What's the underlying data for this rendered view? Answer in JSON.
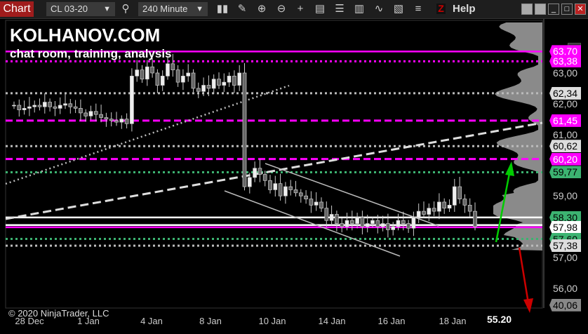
{
  "toolbar": {
    "chart_tab": "Chart",
    "instrument": "CL 03-20",
    "interval": "240 Minute",
    "z_label": "Z",
    "help": "Help"
  },
  "overlay": {
    "brand": "KOLHANOV.COM",
    "subtitle": "chat room, training, analysis",
    "copyright": "© 2020 NinjaTrader, LLC",
    "target": "55.20",
    "f_button": "F"
  },
  "price_axis": {
    "ticks": [
      "63,00",
      "62,00",
      "61,00",
      "59,00",
      "57,00",
      "56,00"
    ]
  },
  "price_labels": [
    {
      "text": "63,70",
      "price": 63.7,
      "bg": "#ff00ff",
      "fg": "#ffffff"
    },
    {
      "text": "63,38",
      "price": 63.38,
      "bg": "#ff00ff",
      "fg": "#ffffff"
    },
    {
      "text": "62,34",
      "price": 62.34,
      "bg": "#dddddd",
      "fg": "#000000"
    },
    {
      "text": "61,45",
      "price": 61.45,
      "bg": "#ff00ff",
      "fg": "#ffffff"
    },
    {
      "text": "60,62",
      "price": 60.62,
      "bg": "#dddddd",
      "fg": "#000000"
    },
    {
      "text": "60,20",
      "price": 60.2,
      "bg": "#ff00ff",
      "fg": "#ffffff"
    },
    {
      "text": "59,77",
      "price": 59.77,
      "bg": "#3cb371",
      "fg": "#000000"
    },
    {
      "text": "58,30",
      "price": 58.3,
      "bg": "#3cb371",
      "fg": "#000000"
    },
    {
      "text": "57,98",
      "price": 57.98,
      "bg": "#ffffff",
      "fg": "#000000"
    },
    {
      "text": "57,60",
      "price": 57.6,
      "bg": "#3cb371",
      "fg": "#000000"
    },
    {
      "text": "57,38",
      "price": 57.38,
      "bg": "#dddddd",
      "fg": "#000000"
    },
    {
      "text": "40,06",
      "price": 55.45,
      "bg": "#888888",
      "fg": "#000000"
    }
  ],
  "date_axis": {
    "ticks": [
      "28 Dec",
      "1 Jan",
      "4 Jan",
      "8 Jan",
      "10 Jan",
      "14 Jan",
      "16 Jan",
      "18 Jan"
    ]
  },
  "chart_data": {
    "type": "candlestick",
    "symbol": "CL 03-20",
    "interval": "240 Minute",
    "closes": [
      61.95,
      61.8,
      61.85,
      61.9,
      61.95,
      61.9,
      62.05,
      61.9,
      61.85,
      61.95,
      62.0,
      61.9,
      61.85,
      61.7,
      61.6,
      61.75,
      61.65,
      61.55,
      61.5,
      61.45,
      61.4,
      61.5,
      61.35,
      62.9,
      63.1,
      62.8,
      63.2,
      63.0,
      62.6,
      62.9,
      63.3,
      63.1,
      62.7,
      62.9,
      63.0,
      62.5,
      62.4,
      62.6,
      62.5,
      62.8,
      62.6,
      62.7,
      62.9,
      62.6,
      63.0,
      59.3,
      59.6,
      59.9,
      59.7,
      59.5,
      59.2,
      59.4,
      59.0,
      59.3,
      59.2,
      59.1,
      59.0,
      58.9,
      58.7,
      58.8,
      58.6,
      58.2,
      58.4,
      58.1,
      58.0,
      58.2,
      58.1,
      58.3,
      58.0,
      58.1,
      58.2,
      58.0,
      58.1,
      57.9,
      58.0,
      58.2,
      58.1,
      57.95,
      58.3,
      58.5,
      58.4,
      58.6,
      58.5,
      58.8,
      58.6,
      58.7,
      59.3,
      58.9,
      58.7,
      58.5,
      58.0
    ],
    "levels": [
      {
        "price": 63.7,
        "color": "#ff00ff",
        "style": "solid"
      },
      {
        "price": 63.38,
        "color": "#ff00ff",
        "style": "dotted"
      },
      {
        "price": 62.34,
        "color": "#bbbbbb",
        "style": "dotted"
      },
      {
        "price": 61.45,
        "color": "#ff00ff",
        "style": "dashed"
      },
      {
        "price": 60.62,
        "color": "#bbbbbb",
        "style": "dotted"
      },
      {
        "price": 60.2,
        "color": "#ff00ff",
        "style": "dashed"
      },
      {
        "price": 59.77,
        "color": "#3cb371",
        "style": "dotted"
      },
      {
        "price": 58.3,
        "color": "#ffffff",
        "style": "solid"
      },
      {
        "price": 58.05,
        "color": "#ffffff",
        "style": "solid"
      },
      {
        "price": 57.98,
        "color": "#ff00ff",
        "style": "solid"
      },
      {
        "price": 57.6,
        "color": "#3cb371",
        "style": "dotted"
      },
      {
        "price": 57.38,
        "color": "#bbbbbb",
        "style": "dotted"
      }
    ]
  }
}
